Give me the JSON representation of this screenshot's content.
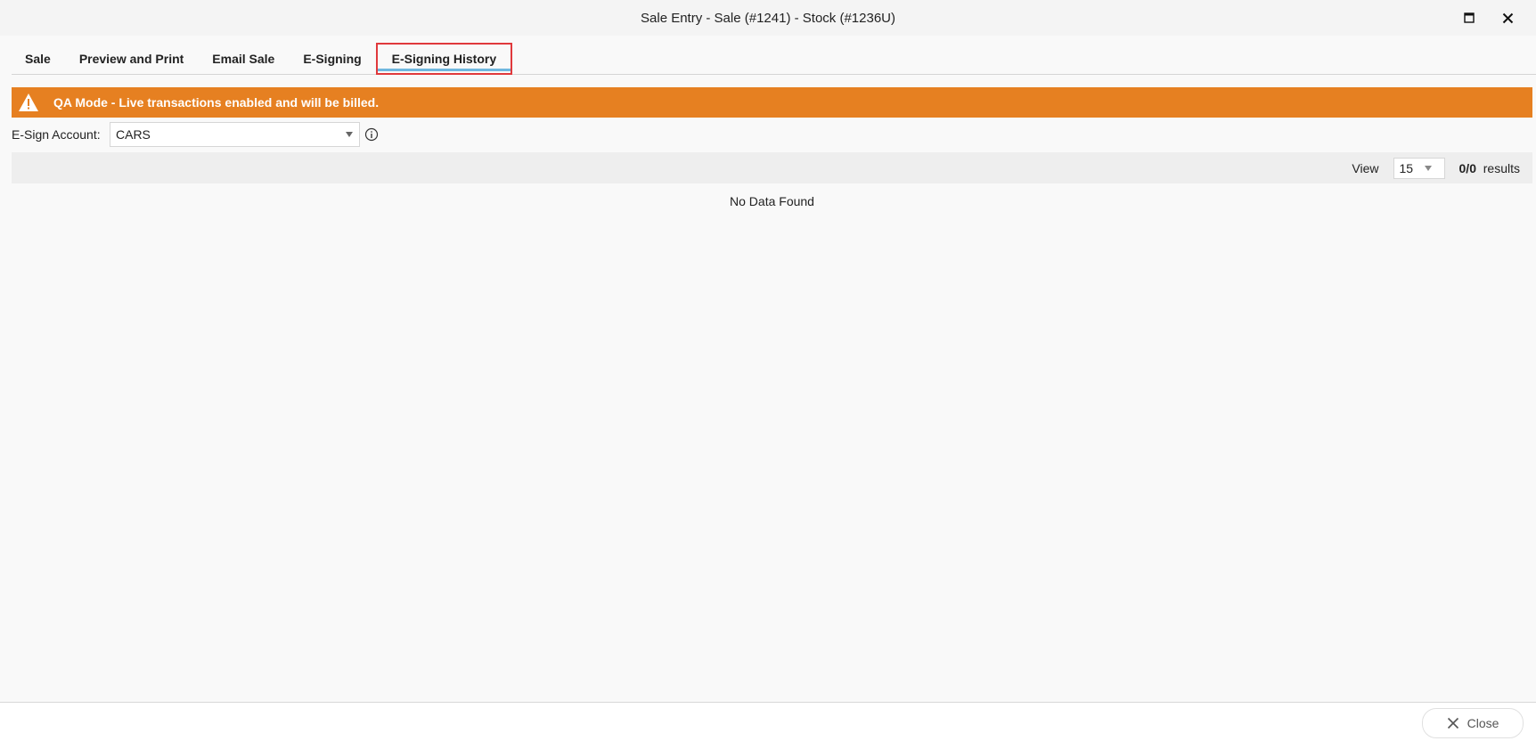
{
  "window": {
    "title": "Sale Entry - Sale (#1241) - Stock (#1236U)"
  },
  "tabs": [
    {
      "label": "Sale"
    },
    {
      "label": "Preview and Print"
    },
    {
      "label": "Email Sale"
    },
    {
      "label": "E-Signing"
    },
    {
      "label": "E-Signing History",
      "active": true
    }
  ],
  "banner": {
    "text": "QA Mode - Live transactions enabled and will be billed.",
    "color": "#e68021"
  },
  "esign": {
    "label": "E-Sign Account:",
    "selected": "CARS"
  },
  "grid": {
    "view_label": "View",
    "page_size": "15",
    "results_count": "0/0",
    "results_suffix": "results",
    "empty_text": "No Data Found"
  },
  "footer": {
    "close_label": "Close"
  },
  "icons": {
    "maximize": "maximize-icon",
    "close": "close-icon",
    "warning": "warning-icon",
    "info": "info-icon"
  }
}
